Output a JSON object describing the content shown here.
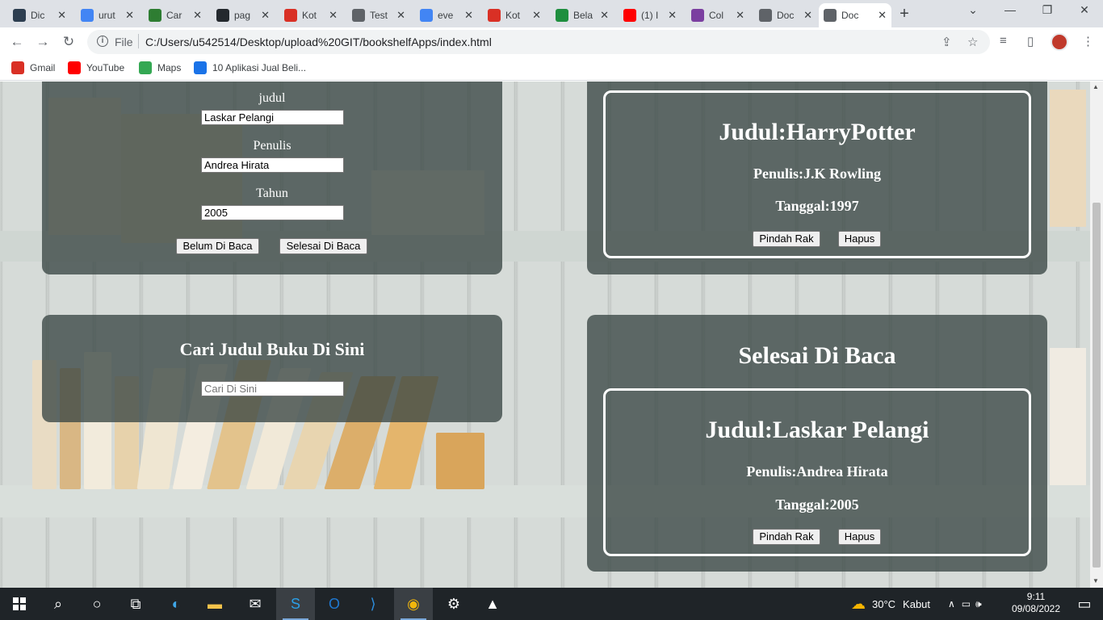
{
  "browser": {
    "tabs": [
      {
        "title": "Dic",
        "icon": "dicoding-icon",
        "color": "#2d3e50"
      },
      {
        "title": "urut",
        "icon": "google-icon",
        "color": "#4285f4"
      },
      {
        "title": "Car",
        "icon": "three-icon",
        "color": "#2e7d32"
      },
      {
        "title": "pag",
        "icon": "github-icon",
        "color": "#24292e"
      },
      {
        "title": "Kot",
        "icon": "gmail-icon",
        "color": "#d93025"
      },
      {
        "title": "Test",
        "icon": "globe-icon",
        "color": "#5f6368"
      },
      {
        "title": "eve",
        "icon": "google-icon",
        "color": "#4285f4"
      },
      {
        "title": "Kot",
        "icon": "gmail-icon",
        "color": "#d93025"
      },
      {
        "title": "Bela",
        "icon": "book-icon",
        "color": "#1e8e3e"
      },
      {
        "title": "(1) I",
        "icon": "youtube-icon",
        "color": "#ff0000"
      },
      {
        "title": "Col",
        "icon": "cup-icon",
        "color": "#7b3fa0"
      },
      {
        "title": "Doc",
        "icon": "globe-icon",
        "color": "#5f6368"
      },
      {
        "title": "Doc",
        "icon": "globe-icon",
        "color": "#5f6368",
        "active": true
      }
    ],
    "new_tab": "+",
    "url_scheme": "File",
    "url": "C:/Users/u542514/Desktop/upload%20GIT/bookshelfApps/index.html",
    "bookmarks": [
      {
        "label": "Gmail",
        "icon": "gmail-icon",
        "color": "#d93025"
      },
      {
        "label": "YouTube",
        "icon": "youtube-icon",
        "color": "#ff0000"
      },
      {
        "label": "Maps",
        "icon": "maps-icon",
        "color": "#34a853"
      },
      {
        "label": "10 Aplikasi Jual Beli...",
        "icon": "app-icon",
        "color": "#1a73e8"
      }
    ]
  },
  "form": {
    "title_label": "judul",
    "title_value": "Laskar Pelangi",
    "author_label": "Penulis",
    "author_value": "Andrea Hirata",
    "year_label": "Tahun",
    "year_value": "2005",
    "unread_button": "Belum Di Baca",
    "read_button": "Selesai Di Baca"
  },
  "search": {
    "heading": "Cari Judul Buku Di Sini",
    "placeholder": "Cari Di Sini"
  },
  "unread_shelf": {
    "books": [
      {
        "title": "Judul:HarryPotter",
        "author": "Penulis:J.K Rowling",
        "year": "Tanggal:1997",
        "move_button": "Pindah Rak",
        "delete_button": "Hapus"
      }
    ]
  },
  "read_shelf": {
    "heading": "Selesai Di Baca",
    "books": [
      {
        "title": "Judul:Laskar Pelangi",
        "author": "Penulis:Andrea Hirata",
        "year": "Tanggal:2005",
        "move_button": "Pindah Rak",
        "delete_button": "Hapus"
      }
    ]
  },
  "taskbar": {
    "weather_temp": "30°C",
    "weather_desc": "Kabut",
    "time": "9:11",
    "date": "09/08/2022"
  }
}
